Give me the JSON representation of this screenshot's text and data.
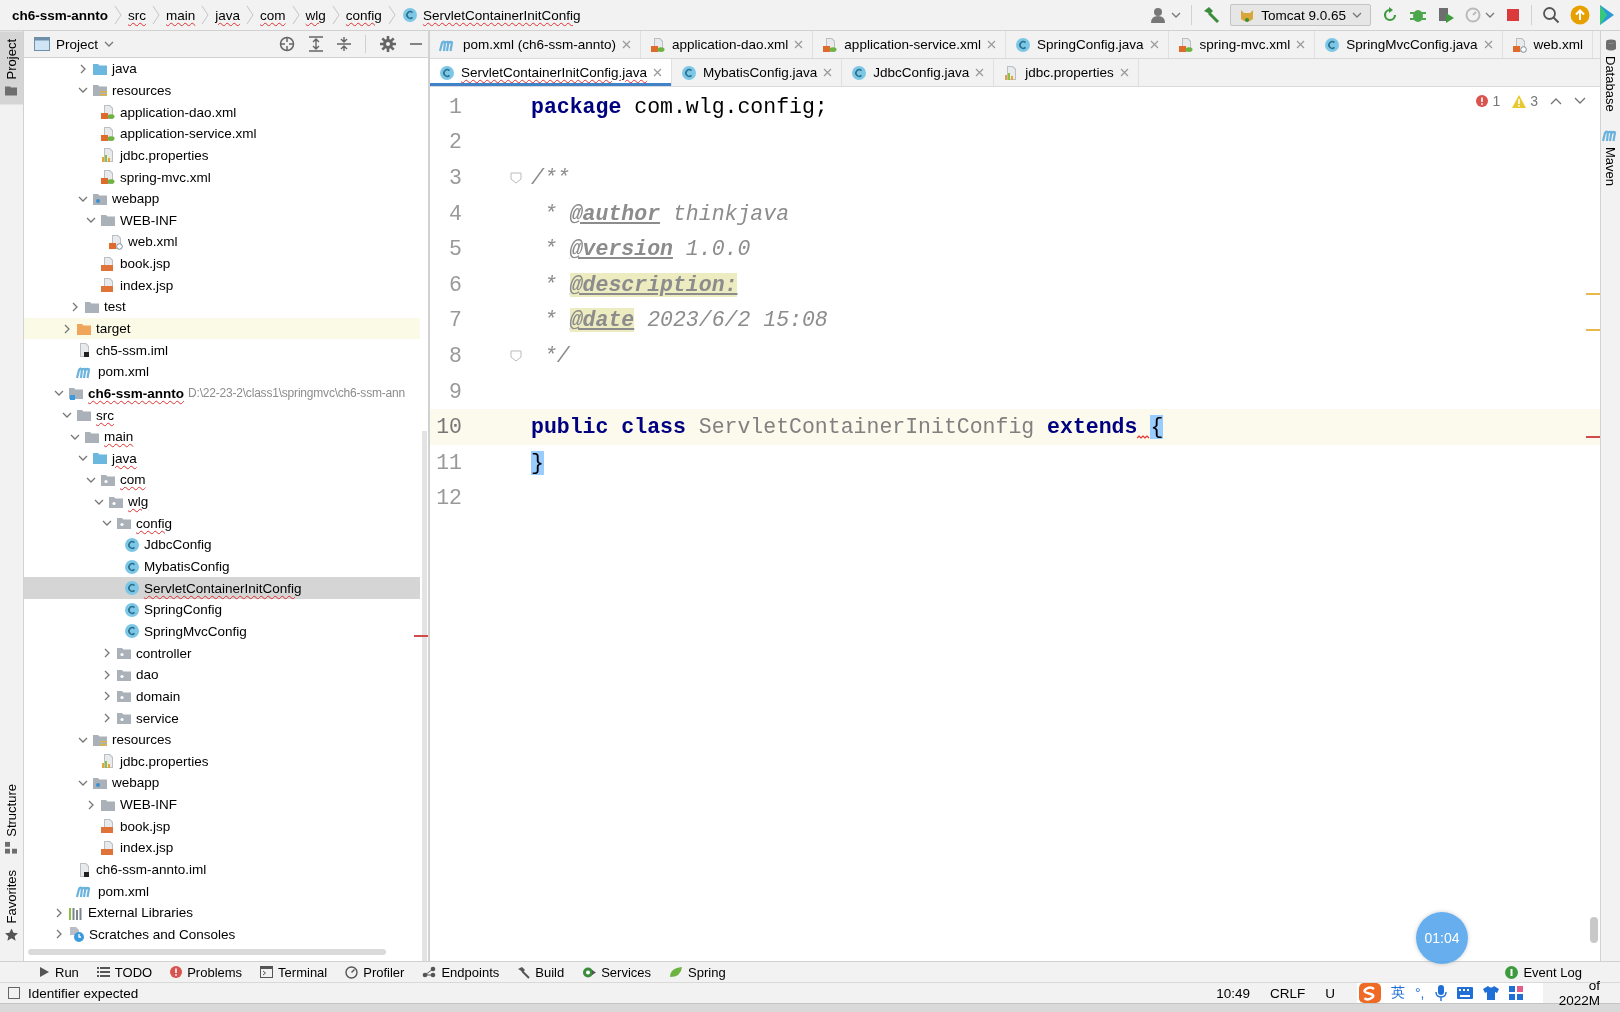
{
  "breadcrumbs": [
    {
      "label": "ch6-ssm-annto",
      "kind": "module",
      "error": false
    },
    {
      "label": "src",
      "kind": "folder",
      "error": true
    },
    {
      "label": "main",
      "kind": "folder",
      "error": true
    },
    {
      "label": "java",
      "kind": "folder",
      "error": true
    },
    {
      "label": "com",
      "kind": "folder",
      "error": true
    },
    {
      "label": "wlg",
      "kind": "folder",
      "error": true
    },
    {
      "label": "config",
      "kind": "folder",
      "error": true
    },
    {
      "label": "ServletContainerInitConfig",
      "kind": "class",
      "error": true
    }
  ],
  "toolbar": {
    "run_config": "Tomcat 9.0.65"
  },
  "left_stripe": [
    {
      "label": "Project",
      "kind": "project",
      "selected": true
    },
    {
      "label": "Structure",
      "kind": "structure",
      "selected": false
    },
    {
      "label": "Favorites",
      "kind": "favorites",
      "selected": false
    }
  ],
  "project": {
    "title": "Project",
    "tree": [
      {
        "children": [
          {
            "children": [
              {
                "children": [
                  {
                    "label": "java",
                    "kind": "src-folder",
                    "expanded": false,
                    "selected": false,
                    "error": false
                  },
                  {
                    "label": "resources",
                    "kind": "resources",
                    "expanded": true,
                    "selected": false,
                    "error": false,
                    "children": [
                      {
                        "label": "application-dao.xml",
                        "kind": "xml",
                        "selected": false,
                        "error": false
                      },
                      {
                        "label": "application-service.xml",
                        "kind": "xml",
                        "selected": false,
                        "error": false
                      },
                      {
                        "label": "jdbc.properties",
                        "kind": "properties",
                        "selected": false,
                        "error": false
                      },
                      {
                        "label": "spring-mvc.xml",
                        "kind": "xml",
                        "selected": false,
                        "error": false
                      }
                    ]
                  },
                  {
                    "label": "webapp",
                    "kind": "webapp",
                    "expanded": true,
                    "selected": false,
                    "error": false,
                    "children": [
                      {
                        "label": "WEB-INF",
                        "kind": "folder",
                        "expanded": true,
                        "selected": false,
                        "error": false,
                        "children": [
                          {
                            "label": "web.xml",
                            "kind": "xml-web",
                            "selected": false,
                            "error": false
                          }
                        ]
                      },
                      {
                        "label": "book.jsp",
                        "kind": "jsp",
                        "selected": false,
                        "error": false
                      },
                      {
                        "label": "index.jsp",
                        "kind": "jsp",
                        "selected": false,
                        "error": false
                      }
                    ]
                  }
                ]
              },
              {
                "label": "test",
                "kind": "folder",
                "expanded": false,
                "selected": false,
                "error": false
              }
            ]
          },
          {
            "label": "target",
            "kind": "excluded",
            "expanded": false,
            "selected": false,
            "error": false
          },
          {
            "label": "ch5-ssm.iml",
            "kind": "iml",
            "selected": false,
            "error": false
          },
          {
            "label": "pom.xml",
            "kind": "maven",
            "selected": false,
            "error": false
          }
        ]
      },
      {
        "label": "ch6-ssm-annto",
        "kind": "module",
        "hint": "D:\\22-23-2\\class1\\springmvc\\ch6-ssm-ann",
        "expanded": true,
        "selected": false,
        "error": true,
        "children": [
          {
            "label": "src",
            "kind": "folder",
            "expanded": true,
            "selected": false,
            "error": true,
            "children": [
              {
                "label": "main",
                "kind": "folder",
                "expanded": true,
                "selected": false,
                "error": true,
                "children": [
                  {
                    "label": "java",
                    "kind": "src-folder",
                    "expanded": true,
                    "selected": false,
                    "error": true,
                    "children": [
                      {
                        "label": "com",
                        "kind": "package",
                        "expanded": true,
                        "selected": false,
                        "error": true,
                        "children": [
                          {
                            "label": "wlg",
                            "kind": "package",
                            "expanded": true,
                            "selected": false,
                            "error": true,
                            "children": [
                              {
                                "label": "config",
                                "kind": "package",
                                "expanded": true,
                                "selected": false,
                                "error": true,
                                "children": [
                                  {
                                    "label": "JdbcConfig",
                                    "kind": "class",
                                    "selected": false,
                                    "error": false
                                  },
                                  {
                                    "label": "MybatisConfig",
                                    "kind": "class",
                                    "selected": false,
                                    "error": false
                                  },
                                  {
                                    "label": "ServletContainerInitConfig",
                                    "kind": "class",
                                    "selected": true,
                                    "error": true
                                  },
                                  {
                                    "label": "SpringConfig",
                                    "kind": "class",
                                    "selected": false,
                                    "error": false
                                  },
                                  {
                                    "label": "SpringMvcConfig",
                                    "kind": "class",
                                    "selected": false,
                                    "error": false
                                  }
                                ]
                              },
                              {
                                "label": "controller",
                                "kind": "package",
                                "expanded": false,
                                "selected": false,
                                "error": false
                              },
                              {
                                "label": "dao",
                                "kind": "package",
                                "expanded": false,
                                "selected": false,
                                "error": false
                              },
                              {
                                "label": "domain",
                                "kind": "package",
                                "expanded": false,
                                "selected": false,
                                "error": false
                              },
                              {
                                "label": "service",
                                "kind": "package",
                                "expanded": false,
                                "selected": false,
                                "error": false
                              }
                            ]
                          }
                        ]
                      }
                    ]
                  },
                  {
                    "label": "resources",
                    "kind": "resources",
                    "expanded": true,
                    "selected": false,
                    "error": false,
                    "children": [
                      {
                        "label": "jdbc.properties",
                        "kind": "properties",
                        "selected": false,
                        "error": false
                      }
                    ]
                  },
                  {
                    "label": "webapp",
                    "kind": "webapp",
                    "expanded": true,
                    "selected": false,
                    "error": false,
                    "children": [
                      {
                        "label": "WEB-INF",
                        "kind": "folder",
                        "expanded": false,
                        "selected": false,
                        "error": false
                      },
                      {
                        "label": "book.jsp",
                        "kind": "jsp",
                        "selected": false,
                        "error": false
                      },
                      {
                        "label": "index.jsp",
                        "kind": "jsp",
                        "selected": false,
                        "error": false
                      }
                    ]
                  }
                ]
              }
            ]
          },
          {
            "label": "ch6-ssm-annto.iml",
            "kind": "iml",
            "selected": false,
            "error": false
          },
          {
            "label": "pom.xml",
            "kind": "maven",
            "selected": false,
            "error": false
          }
        ]
      },
      {
        "label": "External Libraries",
        "kind": "libs",
        "expanded": false,
        "selected": false,
        "error": false
      },
      {
        "label": "Scratches and Consoles",
        "kind": "scratches",
        "expanded": false,
        "selected": false,
        "error": false
      }
    ]
  },
  "editor": {
    "tab_rows": [
      [
        {
          "label": "pom.xml (ch6-ssm-annto)",
          "kind": "maven",
          "selected": false,
          "error": false,
          "closable": true
        },
        {
          "label": "application-dao.xml",
          "kind": "xml",
          "selected": false,
          "error": false,
          "closable": true
        },
        {
          "label": "application-service.xml",
          "kind": "xml",
          "selected": false,
          "error": false,
          "closable": true
        },
        {
          "label": "SpringConfig.java",
          "kind": "class",
          "selected": false,
          "error": false,
          "closable": true
        },
        {
          "label": "spring-mvc.xml",
          "kind": "xml",
          "selected": false,
          "error": false,
          "closable": true
        },
        {
          "label": "SpringMvcConfig.java",
          "kind": "class",
          "selected": false,
          "error": false,
          "closable": true
        },
        {
          "label": "web.xml",
          "kind": "xml-web",
          "selected": false,
          "error": false,
          "closable": false
        }
      ],
      [
        {
          "label": "ServletContainerInitConfig.java",
          "kind": "class",
          "selected": true,
          "error": true,
          "closable": true
        },
        {
          "label": "MybatisConfig.java",
          "kind": "class",
          "selected": false,
          "error": false,
          "closable": true
        },
        {
          "label": "JdbcConfig.java",
          "kind": "class",
          "selected": false,
          "error": false,
          "closable": true
        },
        {
          "label": "jdbc.properties",
          "kind": "properties",
          "selected": false,
          "error": false,
          "closable": true
        }
      ]
    ],
    "inspections": {
      "errors": "1",
      "warnings": "3"
    },
    "lines": [
      {
        "number": "1",
        "current": false,
        "tokens": [
          {
            "t": "package",
            "kind": "keyword"
          },
          {
            "t": " com.wlg.config;",
            "kind": "plain"
          }
        ]
      },
      {
        "number": "2",
        "current": false
      },
      {
        "number": "3",
        "current": false,
        "fold": true,
        "tokens": [
          {
            "t": "/**",
            "kind": "comment"
          }
        ]
      },
      {
        "number": "4",
        "current": false,
        "tokens": [
          {
            "t": " * ",
            "kind": "comment"
          },
          {
            "t": "@author",
            "kind": "doctag"
          },
          {
            "t": " thinkjava",
            "kind": "comment"
          }
        ]
      },
      {
        "number": "5",
        "current": false,
        "tokens": [
          {
            "t": " * ",
            "kind": "comment"
          },
          {
            "t": "@version",
            "kind": "doctag"
          },
          {
            "t": " 1.0.0",
            "kind": "comment"
          }
        ]
      },
      {
        "number": "6",
        "current": false,
        "tokens": [
          {
            "t": " * ",
            "kind": "comment"
          },
          {
            "t": "@description:",
            "kind": "doctag-marked"
          }
        ]
      },
      {
        "number": "7",
        "current": false,
        "tokens": [
          {
            "t": " * ",
            "kind": "comment"
          },
          {
            "t": "@date",
            "kind": "doctag-marked"
          },
          {
            "t": " 2023/6/2 15:08",
            "kind": "comment"
          }
        ]
      },
      {
        "number": "8",
        "current": false,
        "fold": true,
        "tokens": [
          {
            "t": " */",
            "kind": "comment"
          }
        ]
      },
      {
        "number": "9",
        "current": false
      },
      {
        "number": "10",
        "current": true,
        "tokens": [
          {
            "t": "public ",
            "kind": "keyword",
            "error": false
          },
          {
            "t": "class",
            "kind": "keyword",
            "error": false
          },
          {
            "t": " ServletContainerInitConfig ",
            "kind": "unused",
            "error": false
          },
          {
            "t": "extends",
            "kind": "keyword",
            "error": false
          },
          {
            "t": "{",
            "kind": "brace",
            "error": true
          }
        ]
      },
      {
        "number": "11",
        "current": false,
        "tokens": [
          {
            "t": "}",
            "kind": "brace"
          }
        ]
      },
      {
        "number": "12",
        "current": false
      }
    ]
  },
  "right_stripe": [
    {
      "label": "Database",
      "kind": "database"
    },
    {
      "label": "Maven",
      "kind": "maven"
    }
  ],
  "tool_windows": [
    {
      "label": "Run",
      "kind": "run"
    },
    {
      "label": "TODO",
      "kind": "todo"
    },
    {
      "label": "Problems",
      "kind": "problems"
    },
    {
      "label": "Terminal",
      "kind": "terminal"
    },
    {
      "label": "Profiler",
      "kind": "profiler"
    },
    {
      "label": "Endpoints",
      "kind": "endpoints"
    },
    {
      "label": "Build",
      "kind": "build"
    },
    {
      "label": "Services",
      "kind": "services"
    },
    {
      "label": "Spring",
      "kind": "spring"
    }
  ],
  "event_log": "Event Log",
  "status_bar": {
    "message": "Identifier expected",
    "position": "10:49",
    "line_separator": "CRLF",
    "encoding": "U",
    "memory": "of 2022M"
  },
  "ime_toolbar": {
    "language": "英",
    "punctuation": "°,"
  },
  "timer": "01:04"
}
